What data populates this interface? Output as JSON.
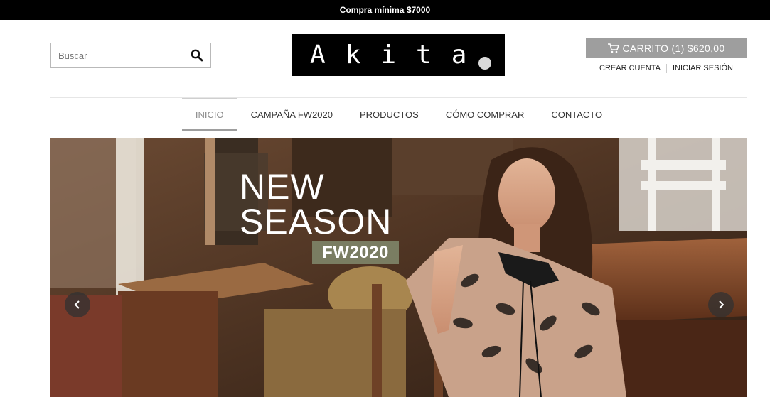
{
  "announcement": "Compra mínima $7000",
  "search": {
    "placeholder": "Buscar"
  },
  "logo": {
    "text": "Akita"
  },
  "cart": {
    "label": "CARRITO (1) $620,00"
  },
  "account": {
    "register": "CREAR CUENTA",
    "login": "INICIAR SESIÓN"
  },
  "nav": {
    "items": [
      "INICIO",
      "CAMPAÑA FW2020",
      "PRODUCTOS",
      "CÓMO COMPRAR",
      "CONTACTO"
    ],
    "active_index": 0
  },
  "hero": {
    "headline_1": "NEW",
    "headline_2": "SEASON",
    "tag": "FW2020"
  },
  "colors": {
    "topbar": "#000000",
    "cart": "#9e9e9e",
    "tag": "#7a7d62"
  }
}
